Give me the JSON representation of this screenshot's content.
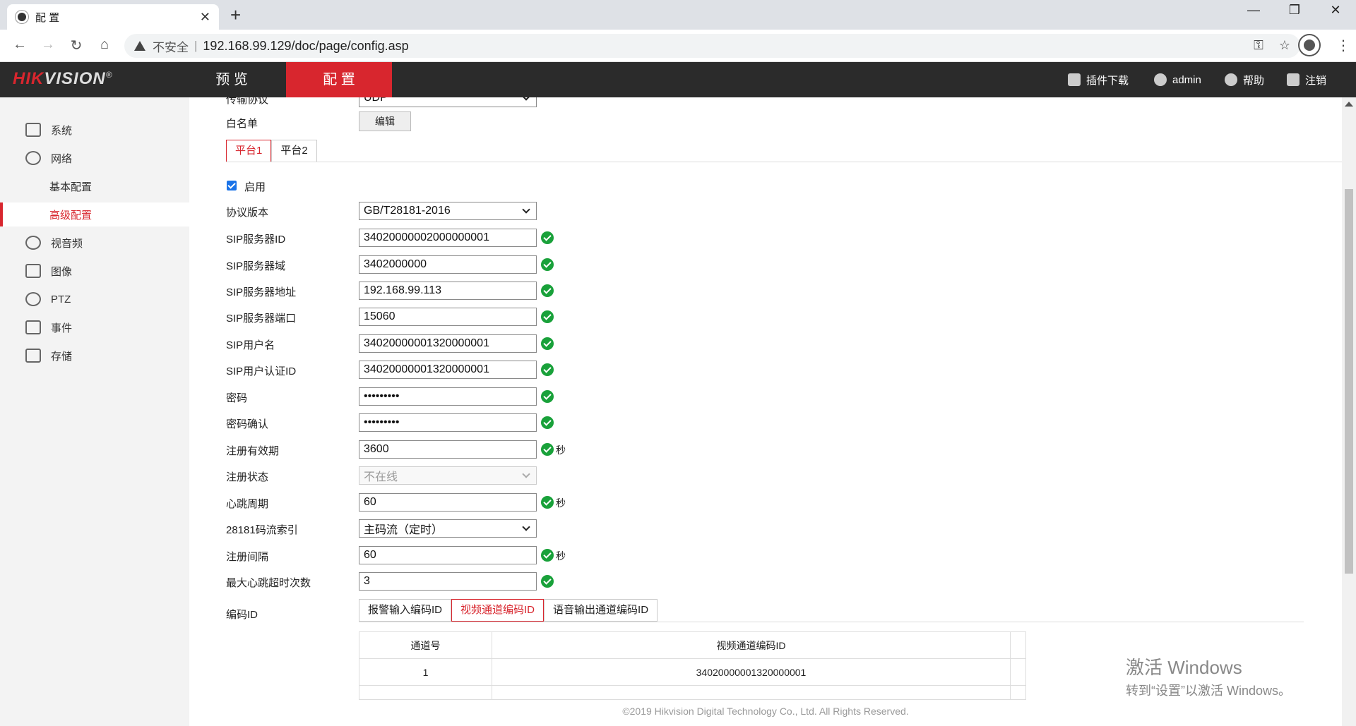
{
  "browser": {
    "tab_title": "配 置",
    "insecure_label": "不安全",
    "separator": "|",
    "url": "192.168.99.129/doc/page/config.asp"
  },
  "header": {
    "logo_hik": "HIK",
    "logo_vision": "VISION",
    "logo_reg": "®",
    "nav": [
      {
        "label": "预 览"
      },
      {
        "label": "配 置",
        "active": true
      }
    ],
    "plugin_download": "插件下载",
    "user": "admin",
    "help": "帮助",
    "logout": "注销"
  },
  "sidebar": {
    "items": [
      {
        "label": "系统"
      },
      {
        "label": "网络"
      },
      {
        "label": "基本配置"
      },
      {
        "label": "高级配置",
        "active": true
      },
      {
        "label": "视音频"
      },
      {
        "label": "图像"
      },
      {
        "label": "PTZ"
      },
      {
        "label": "事件"
      },
      {
        "label": "存储"
      }
    ]
  },
  "form": {
    "cut_label": "传输协议",
    "cut_value": "UDP",
    "whitelist_label": "白名单",
    "edit_button": "编辑",
    "platform_tabs": [
      "平台1",
      "平台2"
    ],
    "enable_label": "启用",
    "enabled": true,
    "rows": [
      {
        "label": "协议版本",
        "value": "GB/T28181-2016",
        "type": "select"
      },
      {
        "label": "SIP服务器ID",
        "value": "34020000002000000001",
        "ok": true
      },
      {
        "label": "SIP服务器域",
        "value": "3402000000",
        "ok": true
      },
      {
        "label": "SIP服务器地址",
        "value": "192.168.99.113",
        "ok": true
      },
      {
        "label": "SIP服务器端口",
        "value": "15060",
        "ok": true
      },
      {
        "label": "SIP用户名",
        "value": "34020000001320000001",
        "ok": true
      },
      {
        "label": "SIP用户认证ID",
        "value": "34020000001320000001",
        "ok": true
      },
      {
        "label": "密码",
        "value": "•••••••••",
        "ok": true
      },
      {
        "label": "密码确认",
        "value": "•••••••••",
        "ok": true
      },
      {
        "label": "注册有效期",
        "value": "3600",
        "ok": true,
        "unit": "秒"
      },
      {
        "label": "注册状态",
        "value": "不在线",
        "type": "select-disabled"
      },
      {
        "label": "心跳周期",
        "value": "60",
        "ok": true,
        "unit": "秒"
      },
      {
        "label": "28181码流索引",
        "value": "主码流（定时）",
        "type": "select"
      },
      {
        "label": "注册间隔",
        "value": "60",
        "ok": true,
        "unit": "秒"
      },
      {
        "label": "最大心跳超时次数",
        "value": "3",
        "ok": true
      }
    ],
    "code_id_label": "编码ID",
    "code_tabs": [
      "报警输入编码ID",
      "视频通道编码ID",
      "语音输出通道编码ID"
    ],
    "table": {
      "headers": [
        "通道号",
        "视频通道编码ID"
      ],
      "rows": [
        [
          "1",
          "34020000001320000001"
        ]
      ]
    }
  },
  "footer": "©2019 Hikvision Digital Technology Co., Ltd. All Rights Reserved.",
  "watermark": {
    "line1": "激活 Windows",
    "line2": "转到“设置”以激活 Windows。"
  },
  "colors": {
    "brand_red": "#d8262e",
    "header_bg": "#2b2b2b",
    "ok_green": "#19a13a"
  }
}
